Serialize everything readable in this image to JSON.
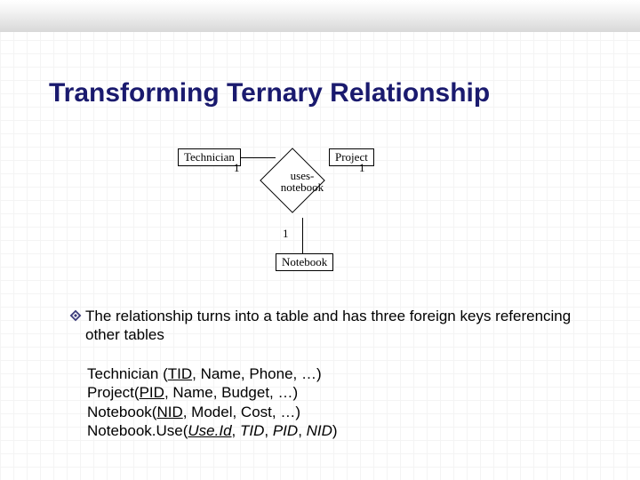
{
  "title": "Transforming Ternary Relationship",
  "diagram": {
    "entities": {
      "technician": "Technician",
      "project": "Project",
      "notebook": "Notebook"
    },
    "relationship": {
      "line1": "uses-",
      "line2": "notebook"
    },
    "cardinality": {
      "tech": "1",
      "proj": "1",
      "nb": "1"
    }
  },
  "bullet": "The relationship turns into a table and has three foreign keys referencing other tables",
  "schema": {
    "technician": {
      "name": "Technician ",
      "open": "(",
      "pk": "TID",
      "rest": ", Name, Phone, …)"
    },
    "project": {
      "name": "Project",
      "open": "(",
      "pk": "PID",
      "rest": ", Name, Budget, …)"
    },
    "notebook": {
      "name": "Notebook",
      "open": "(",
      "pk": "NID",
      "rest": ", Model, Cost, …)"
    },
    "use": {
      "name": "Notebook.Use",
      "open": "(",
      "pk": "Use.Id",
      "sep1": ",",
      "fk1": " TID",
      "sep2": ", ",
      "fk2": "PID",
      "sep3": ", ",
      "fk3": "NID",
      "close": ")"
    }
  }
}
